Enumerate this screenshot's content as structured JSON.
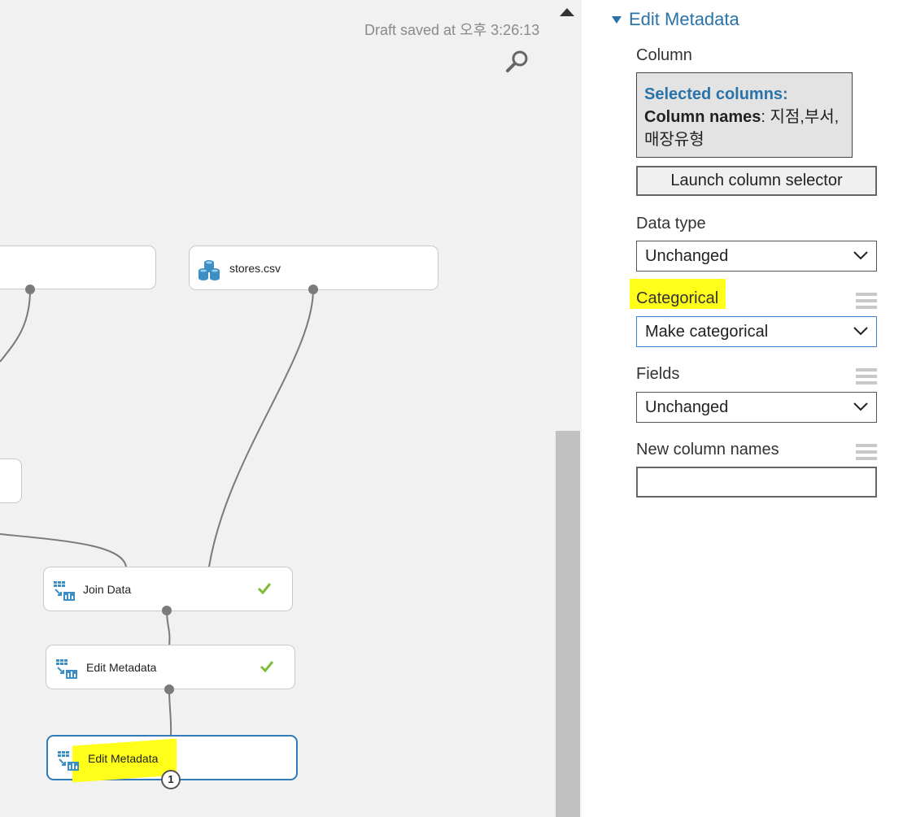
{
  "canvas": {
    "draft_status": "Draft saved at 오후 3:26:13",
    "search_icon": "search-icon",
    "modules": {
      "stores": {
        "label": "stores.csv",
        "icon": "dataset-icon"
      },
      "join": {
        "label": "Join Data",
        "icon": "module-icon",
        "status": "check-icon"
      },
      "edit1": {
        "label": "Edit Metadata",
        "icon": "module-icon",
        "status": "check-icon"
      },
      "edit2": {
        "label": "Edit Metadata",
        "icon": "module-icon",
        "badge": "1"
      }
    }
  },
  "panel": {
    "title": "Edit Metadata",
    "column_label": "Column",
    "selected_columns_title": "Selected columns:",
    "column_names_label": "Column names",
    "column_names_value": ": 지점,부서,매장유형",
    "launch_button": "Launch column selector",
    "data_type_label": "Data type",
    "data_type_value": "Unchanged",
    "categorical_label": "Categorical",
    "categorical_value": "Make categorical",
    "fields_label": "Fields",
    "fields_value": "Unchanged",
    "new_column_names_label": "New column names",
    "new_column_names_value": "",
    "highlight_color": "#ffff1a",
    "accent_color": "#2a73a8"
  }
}
